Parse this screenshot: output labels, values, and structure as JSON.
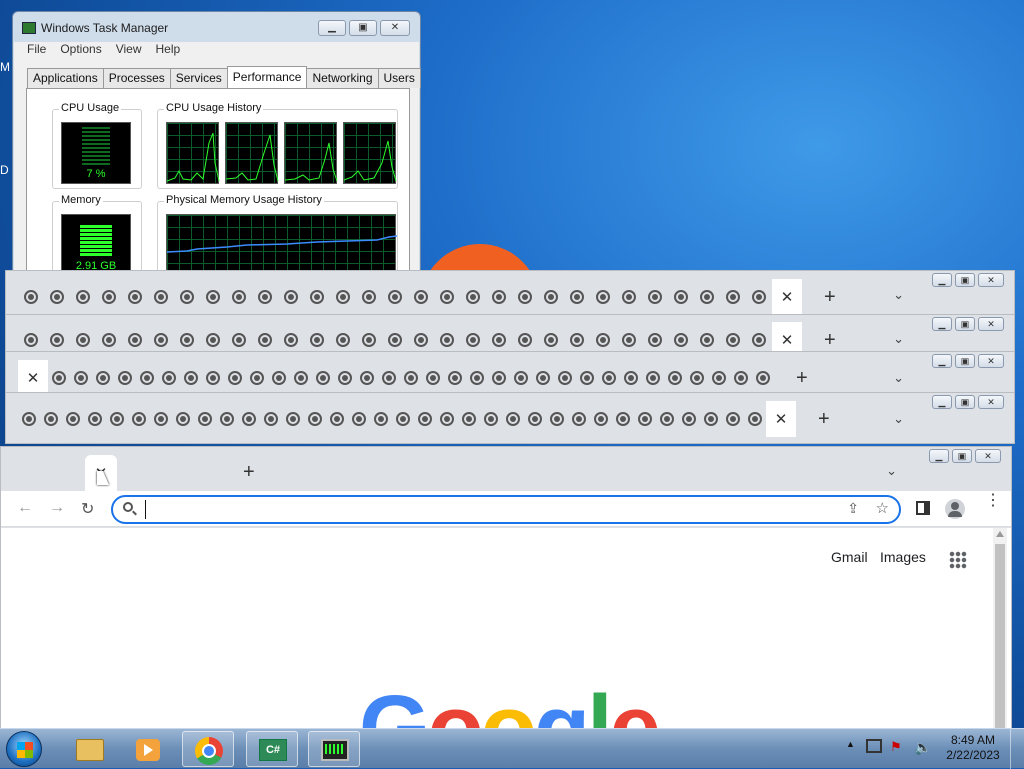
{
  "desktop": {
    "left_letters": [
      "M",
      "D"
    ]
  },
  "taskmanager": {
    "title": "Windows Task Manager",
    "menu": [
      "File",
      "Options",
      "View",
      "Help"
    ],
    "tabs": [
      "Applications",
      "Processes",
      "Services",
      "Performance",
      "Networking",
      "Users"
    ],
    "active_tab": "Performance",
    "cpu_usage_label": "CPU Usage",
    "cpu_usage_value": "7 %",
    "cpu_history_label": "CPU Usage History",
    "memory_label": "Memory",
    "memory_value": "2.91 GB",
    "mem_history_label": "Physical Memory Usage History"
  },
  "chrome_stacked": {
    "tab_close": "✕",
    "new_tab": "+",
    "tab_search": "⌄",
    "minimize": "—",
    "maximize": "☐",
    "close": "✕"
  },
  "chrome_main": {
    "tab_close": "✕",
    "new_tab": "+",
    "tab_search": "⌄",
    "back": "←",
    "forward": "→",
    "reload": "↻",
    "omnibox_value": "",
    "header_links": [
      "Gmail",
      "Images"
    ],
    "logo_text": "Google",
    "logo_colors": [
      "#4285f4",
      "#ea4335",
      "#fbbc05",
      "#4285f4",
      "#34a853",
      "#ea4335"
    ]
  },
  "taskbar": {
    "apps": [
      "start-orb",
      "file-explorer",
      "media-player",
      "chrome",
      "csharp-editor",
      "task-manager"
    ],
    "time": "8:49 AM",
    "date": "2/22/2023"
  }
}
